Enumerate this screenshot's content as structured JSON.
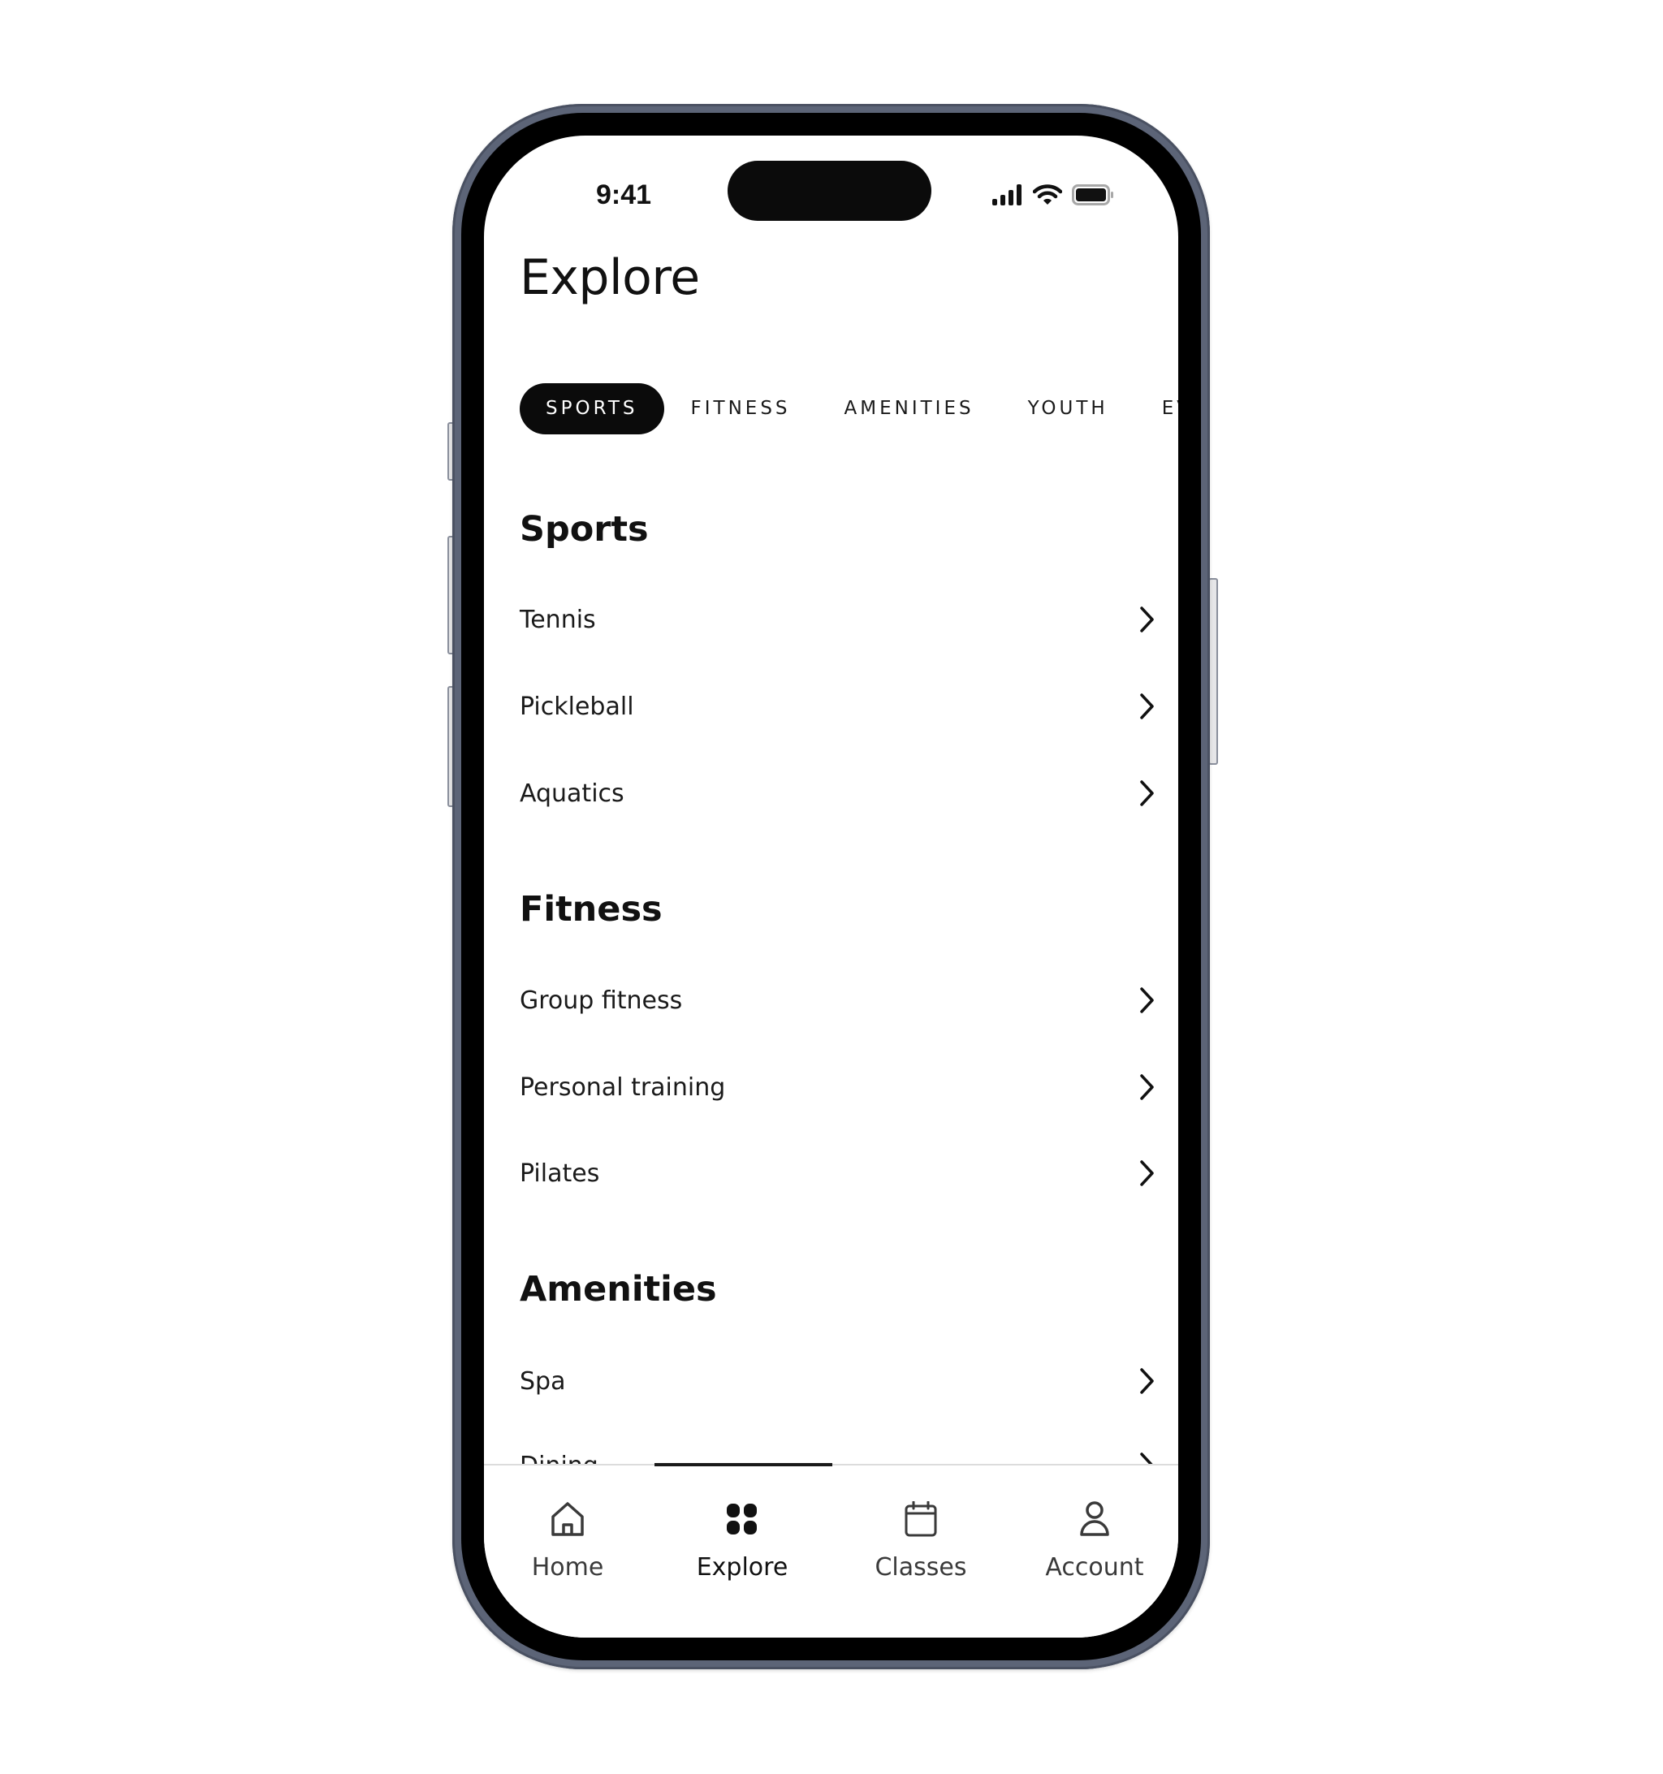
{
  "status_bar": {
    "time": "9:41",
    "icons": [
      "cellular-signal-icon",
      "wifi-icon",
      "battery-icon"
    ]
  },
  "header": {
    "title": "Explore"
  },
  "category_tabs": [
    {
      "label": "SPORTS",
      "active": true
    },
    {
      "label": "FITNESS",
      "active": false
    },
    {
      "label": "AMENITIES",
      "active": false
    },
    {
      "label": "YOUTH",
      "active": false
    },
    {
      "label": "EVENTS",
      "active": false
    }
  ],
  "sections": [
    {
      "title": "Sports",
      "items": [
        {
          "label": "Tennis",
          "icon": "chevron-right-icon"
        },
        {
          "label": "Pickleball",
          "icon": "chevron-right-icon"
        },
        {
          "label": "Aquatics",
          "icon": "chevron-right-icon"
        }
      ]
    },
    {
      "title": "Fitness",
      "items": [
        {
          "label": "Group fitness",
          "icon": "chevron-right-icon"
        },
        {
          "label": "Personal training",
          "icon": "chevron-right-icon"
        },
        {
          "label": "Pilates",
          "icon": "chevron-right-icon"
        }
      ]
    },
    {
      "title": "Amenities",
      "items": [
        {
          "label": "Spa",
          "icon": "chevron-right-icon"
        },
        {
          "label": "Dining",
          "icon": "chevron-right-icon"
        }
      ]
    }
  ],
  "tab_bar": {
    "items": [
      {
        "label": "Home",
        "icon": "home-icon",
        "active": false
      },
      {
        "label": "Explore",
        "icon": "grid-icon",
        "active": true
      },
      {
        "label": "Classes",
        "icon": "calendar-icon",
        "active": false
      },
      {
        "label": "Account",
        "icon": "person-icon",
        "active": false
      }
    ]
  },
  "colors": {
    "frame": "#5c6477",
    "bezel": "#000000",
    "active_pill": "#0b0b0b",
    "text": "#111111",
    "divider": "#dcdcdc"
  }
}
